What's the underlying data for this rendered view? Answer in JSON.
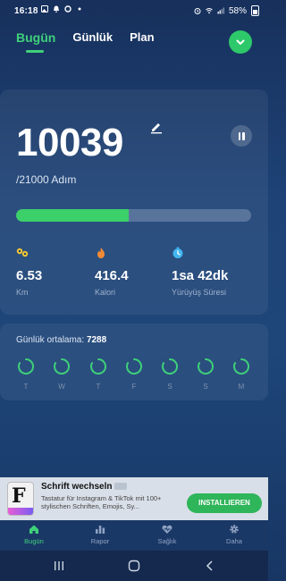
{
  "status_bar": {
    "time": "16:18",
    "battery": "58%"
  },
  "tabs": [
    {
      "label": "Bugün",
      "active": true
    },
    {
      "label": "Günlük",
      "active": false
    },
    {
      "label": "Plan",
      "active": false
    }
  ],
  "steps": {
    "count": "10039",
    "goal": "/21000 Adım",
    "progress_fraction": 0.478
  },
  "stats": [
    {
      "icon": "distance-icon",
      "value": "6.53",
      "label": "Km"
    },
    {
      "icon": "flame-icon",
      "value": "416.4",
      "label": "Kalori"
    },
    {
      "icon": "clock-icon",
      "value": "1sa 42dk",
      "label": "Yürüyüş Süresi"
    }
  ],
  "weekly": {
    "avg_label": "Günlük ortalama:",
    "avg_value": "7288",
    "days": [
      "T",
      "W",
      "T",
      "F",
      "S",
      "S",
      "M"
    ]
  },
  "ad": {
    "title": "Schrift wechseln",
    "description": "Tastatur für Instagram & TikTok mit 100+ stylischen Schriften, Emojis, Sy...",
    "cta": "INSTALLIEREN"
  },
  "bottom_nav": [
    {
      "label": "Bugün",
      "icon": "home-icon",
      "active": true
    },
    {
      "label": "Rapor",
      "icon": "bar-chart-icon",
      "active": false
    },
    {
      "label": "Sağlık",
      "icon": "heart-icon",
      "active": false
    },
    {
      "label": "Daha",
      "icon": "gear-icon",
      "active": false
    }
  ],
  "colors": {
    "accent": "#3fd17a",
    "background": "#1e4377",
    "progress": "#3cd06b",
    "install_button": "#2fb55a"
  }
}
